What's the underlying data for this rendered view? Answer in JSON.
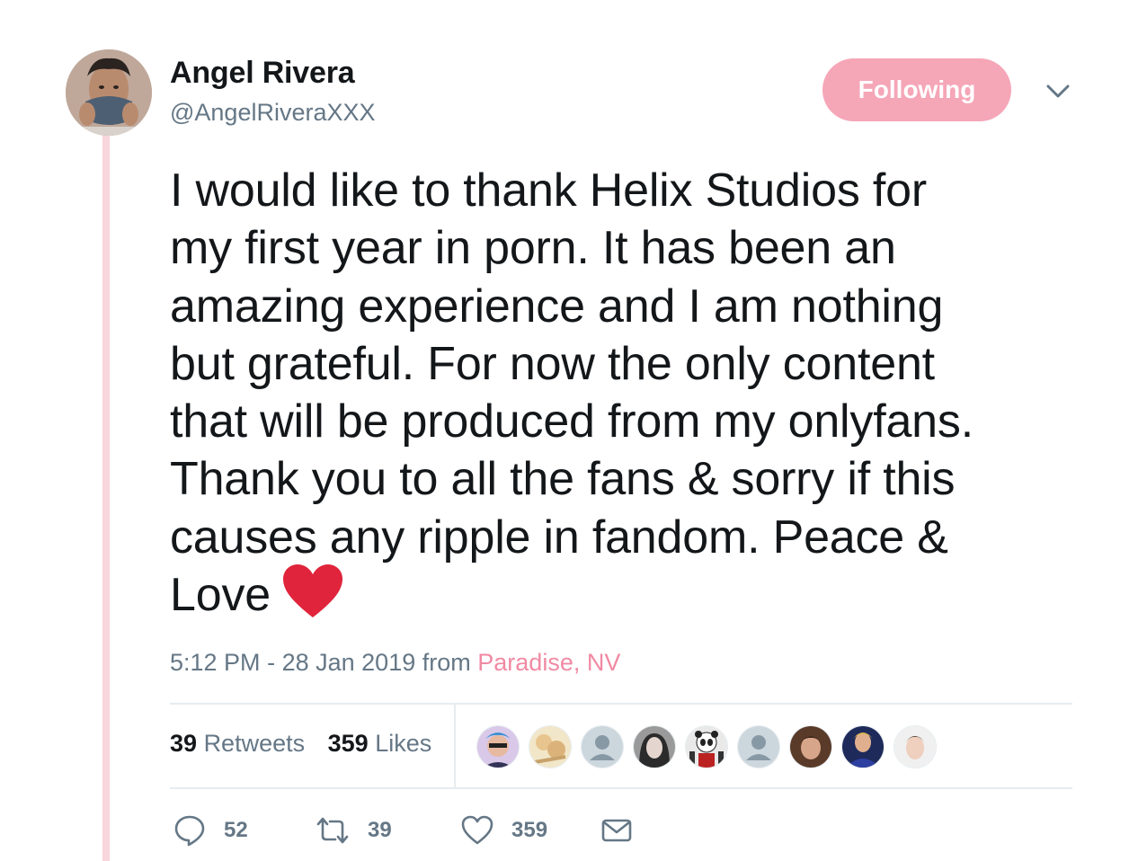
{
  "user": {
    "name": "Angel Rivera",
    "handle": "@AngelRiveraXXX"
  },
  "follow_button": {
    "label": "Following"
  },
  "tweet": {
    "lines": [
      "I would like to thank Helix Studios for",
      "my first year in porn. It has been an",
      "amazing experience and I am nothing",
      "but grateful. For now the only content",
      "that will be produced from my onlyfans.",
      "Thank you to all the fans & sorry if this",
      "causes any ripple in fandom. Peace &",
      "Love"
    ],
    "emoji": "red-heart-emoji"
  },
  "meta": {
    "time": "5:12 PM",
    "separator": "-",
    "date": "28 Jan 2019",
    "from": "from",
    "location": "Paradise, NV"
  },
  "stats": {
    "retweets": {
      "count": "39",
      "label": "Retweets"
    },
    "likes": {
      "count": "359",
      "label": "Likes"
    }
  },
  "likers": [
    "liker-avatar-1",
    "liker-avatar-2",
    "liker-avatar-default",
    "liker-avatar-4",
    "liker-avatar-panda",
    "liker-avatar-default",
    "liker-avatar-7",
    "liker-avatar-8",
    "liker-avatar-9"
  ],
  "actions": {
    "reply": {
      "icon": "reply-icon",
      "count": "52"
    },
    "retweet": {
      "icon": "retweet-icon",
      "count": "39"
    },
    "like": {
      "icon": "heart-icon",
      "count": "359"
    },
    "message": {
      "icon": "envelope-icon"
    }
  },
  "colors": {
    "accent_pink": "#f5a6b7",
    "thread_line": "#f9d5dc",
    "location_link": "#f08aa3",
    "muted_text": "#657786",
    "heart_red": "#e0243b"
  }
}
